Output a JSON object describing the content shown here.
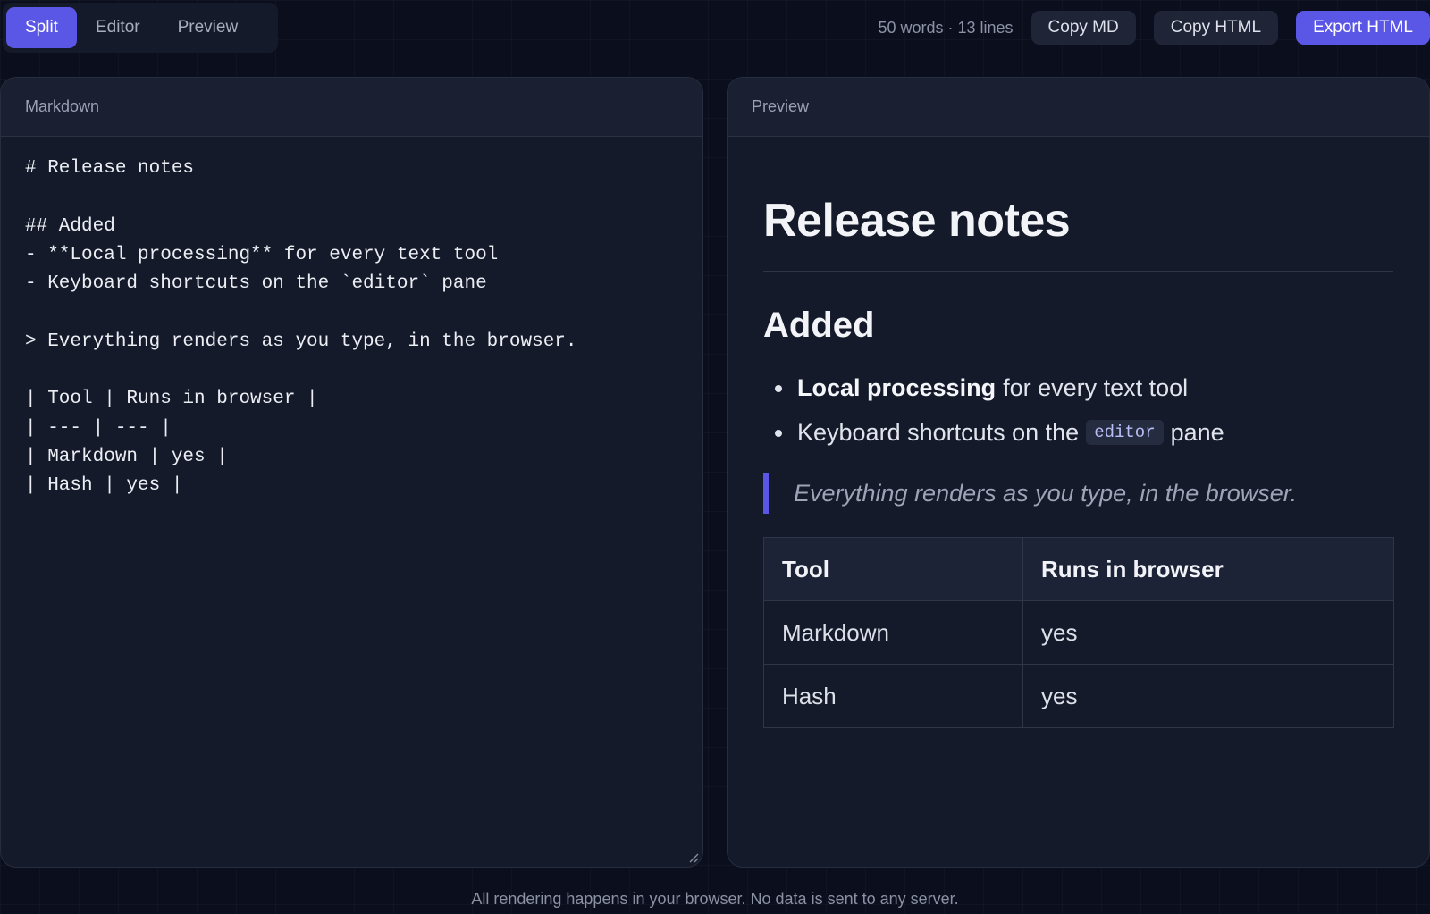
{
  "modes": [
    "Split",
    "Editor",
    "Preview"
  ],
  "active_mode": "Split",
  "stats": "50 words · 13 lines",
  "actions": {
    "copy_md": "Copy MD",
    "copy_html": "Copy HTML",
    "export_html": "Export HTML"
  },
  "editor": {
    "title": "Markdown",
    "lines": [
      "# Release notes",
      "",
      "## Added",
      "- **Local processing** for every text tool",
      "- Keyboard shortcuts on the `editor` pane",
      "",
      "> Everything renders as you type, in the browser.",
      "",
      "| Tool | Runs in browser |",
      "| --- | --- |",
      "| Markdown | yes |",
      "| Hash | yes |",
      ""
    ]
  },
  "preview": {
    "title": "Preview",
    "h1": "Release notes",
    "h2": "Added",
    "list": {
      "item1_bold": "Local processing",
      "item1_rest": "for every text tool",
      "item2_before": "Keyboard shortcuts on the",
      "item2_code": "editor",
      "item2_after": "pane"
    },
    "quote": "Everything renders as you type, in the browser.",
    "table": {
      "headers": [
        "Tool",
        "Runs in browser"
      ],
      "rows": [
        [
          "Markdown",
          "yes"
        ],
        [
          "Hash",
          "yes"
        ]
      ]
    }
  },
  "footer": "All rendering happens in your browser. No data is sent to any server."
}
